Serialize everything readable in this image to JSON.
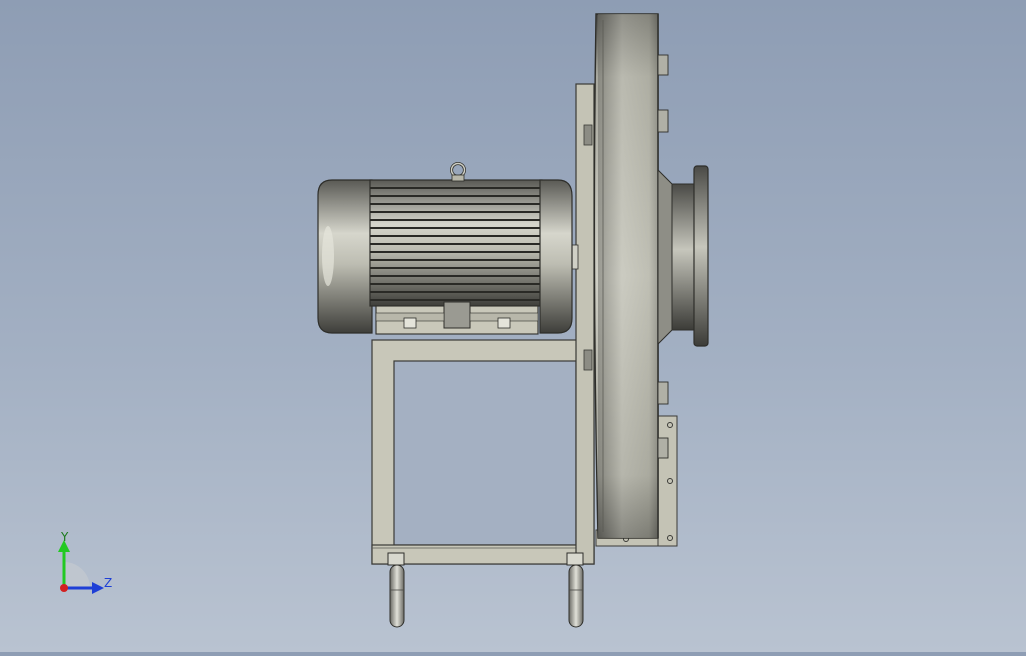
{
  "viewport": {
    "background_top": "#8e9db4",
    "background_bottom": "#b9c3d1"
  },
  "model": {
    "components": [
      "motor-icon",
      "fan-housing-icon",
      "inlet-flange-icon",
      "base-frame-icon",
      "lifting-eye-icon",
      "mounting-bolt-icon"
    ]
  },
  "triad": {
    "y_label": "Y",
    "z_label": "Z",
    "y_color": "#22c922",
    "z_color": "#1e3fd6",
    "x_color": "#d22020"
  }
}
